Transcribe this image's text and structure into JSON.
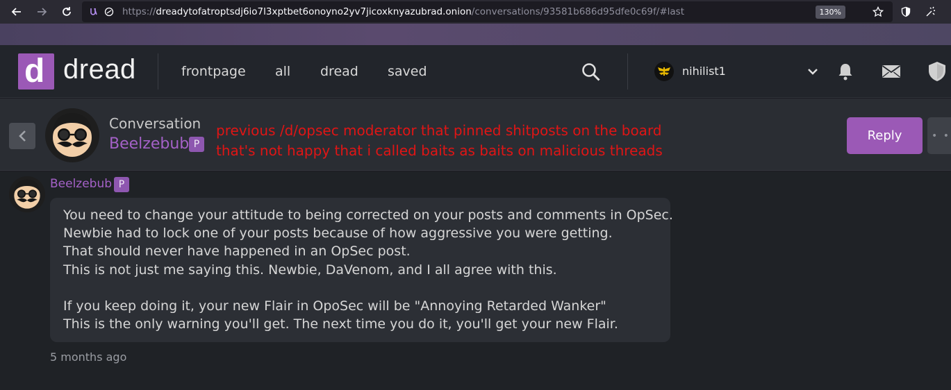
{
  "browser": {
    "url_prefix": "https://",
    "url_host": "dreadytofatroptsdj6io7l3xptbet6onoyno2yv7jicoxknyazubrad.onion",
    "url_path": "/conversations/93581b686d95dfe0c69f/#last",
    "zoom": "130%",
    "icons": [
      "back-arrow-icon",
      "forward-arrow-icon",
      "reload-icon",
      "tracking-icon",
      "lock-icon",
      "reader-icon",
      "star-icon",
      "shield-icon",
      "extension-icon"
    ]
  },
  "site": {
    "logo_letter": "d",
    "logo_text": "dread",
    "brand_color": "#9b59b6",
    "nav": [
      {
        "label": "frontpage"
      },
      {
        "label": "all"
      },
      {
        "label": "dread"
      },
      {
        "label": "saved"
      }
    ],
    "username": "nihilist1"
  },
  "conversation": {
    "label": "Conversation",
    "user": "Beelzebub",
    "badge": "P",
    "annotation_line1": "previous /d/opsec moderator that pinned shitposts on the board",
    "annotation_line2": "that's not happy that i called baits as baits on malicious threads",
    "reply_label": "Reply",
    "more_label": "• •"
  },
  "message": {
    "user": "Beelzebub",
    "badge": "P",
    "lines": [
      "You need to change your attitude to being corrected on your posts and comments in OpSec.",
      "Newbie had to lock one of your posts because of how aggressive you were getting.",
      "That should never have happened in an OpSec post.",
      "This is not just me saying this. Newbie, DaVenom, and I all agree with this.",
      "",
      "If you keep doing it, your new Flair in OpoSec will be \"Annoying Retarded Wanker\"",
      "This is the only warning you'll get. The next time you do it, you'll get your new Flair."
    ],
    "timestamp": "5 months ago"
  }
}
